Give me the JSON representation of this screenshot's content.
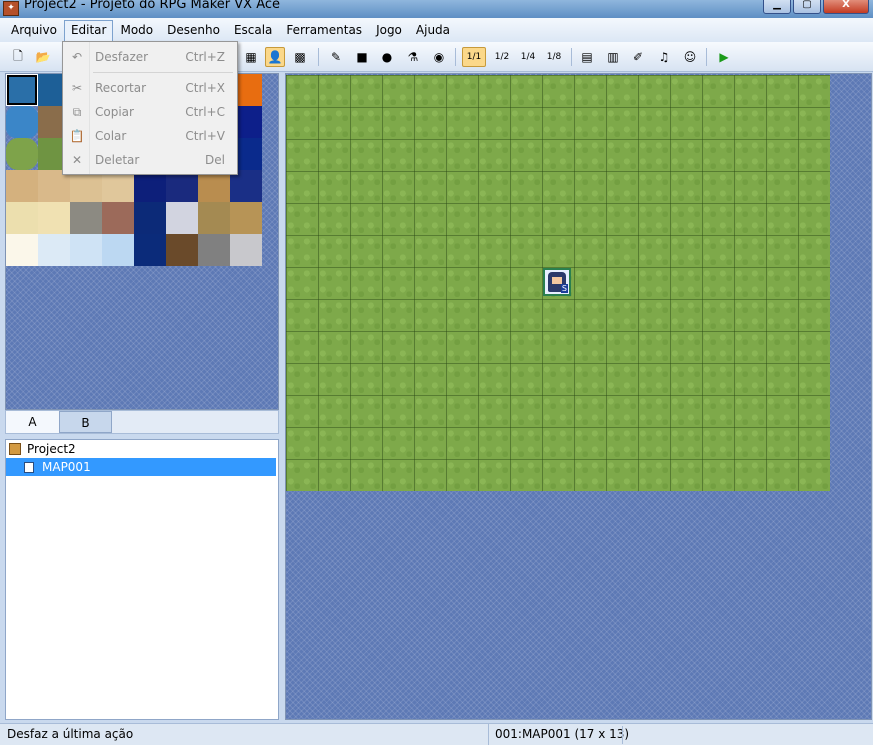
{
  "window": {
    "title": "Project2 - Projeto do RPG Maker VX Ace",
    "app_icon": "rpg-maker-icon",
    "minimize": "▁",
    "maximize": "▢",
    "close": "X"
  },
  "menubar": {
    "items": [
      "Arquivo",
      "Editar",
      "Modo",
      "Desenho",
      "Escala",
      "Ferramentas",
      "Jogo",
      "Ajuda"
    ],
    "active": "Editar"
  },
  "edit_menu": {
    "items": [
      {
        "label": "Desfazer",
        "shortcut": "Ctrl+Z",
        "icon": "undo-icon",
        "enabled": false
      },
      {
        "label": "Recortar",
        "shortcut": "Ctrl+X",
        "icon": "scissors-icon",
        "enabled": false
      },
      {
        "label": "Copiar",
        "shortcut": "Ctrl+C",
        "icon": "copy-icon",
        "enabled": false
      },
      {
        "label": "Colar",
        "shortcut": "Ctrl+V",
        "icon": "paste-icon",
        "enabled": false
      },
      {
        "label": "Deletar",
        "shortcut": "Del",
        "icon": "delete-icon",
        "enabled": false
      }
    ]
  },
  "toolbar": {
    "zoom_labels": [
      "1/1",
      "1/2",
      "1/4",
      "1/8"
    ],
    "active_zoom": "1/1",
    "active_layer_mode": "event-mode"
  },
  "tileset": {
    "tabs": [
      "A",
      "B"
    ],
    "active_tab": "A",
    "selected_tile": 0
  },
  "project_tree": {
    "project_name": "Project2",
    "maps": [
      {
        "id": "001",
        "name": "MAP001",
        "selected": true
      }
    ]
  },
  "map": {
    "name": "MAP001",
    "width_tiles": 17,
    "height_tiles": 13,
    "tile_type": "grass",
    "player_start": {
      "col": 8,
      "row": 6,
      "tag": "S"
    }
  },
  "statusbar": {
    "hint": "Desfaz a última ação",
    "map_info": "001:MAP001 (17 x 13)"
  },
  "colors": {
    "grass": "#7ea94a",
    "background_pattern": "#5d79b5",
    "selection": "#3399ff",
    "menu_disabled_text": "#8d8d8d"
  }
}
